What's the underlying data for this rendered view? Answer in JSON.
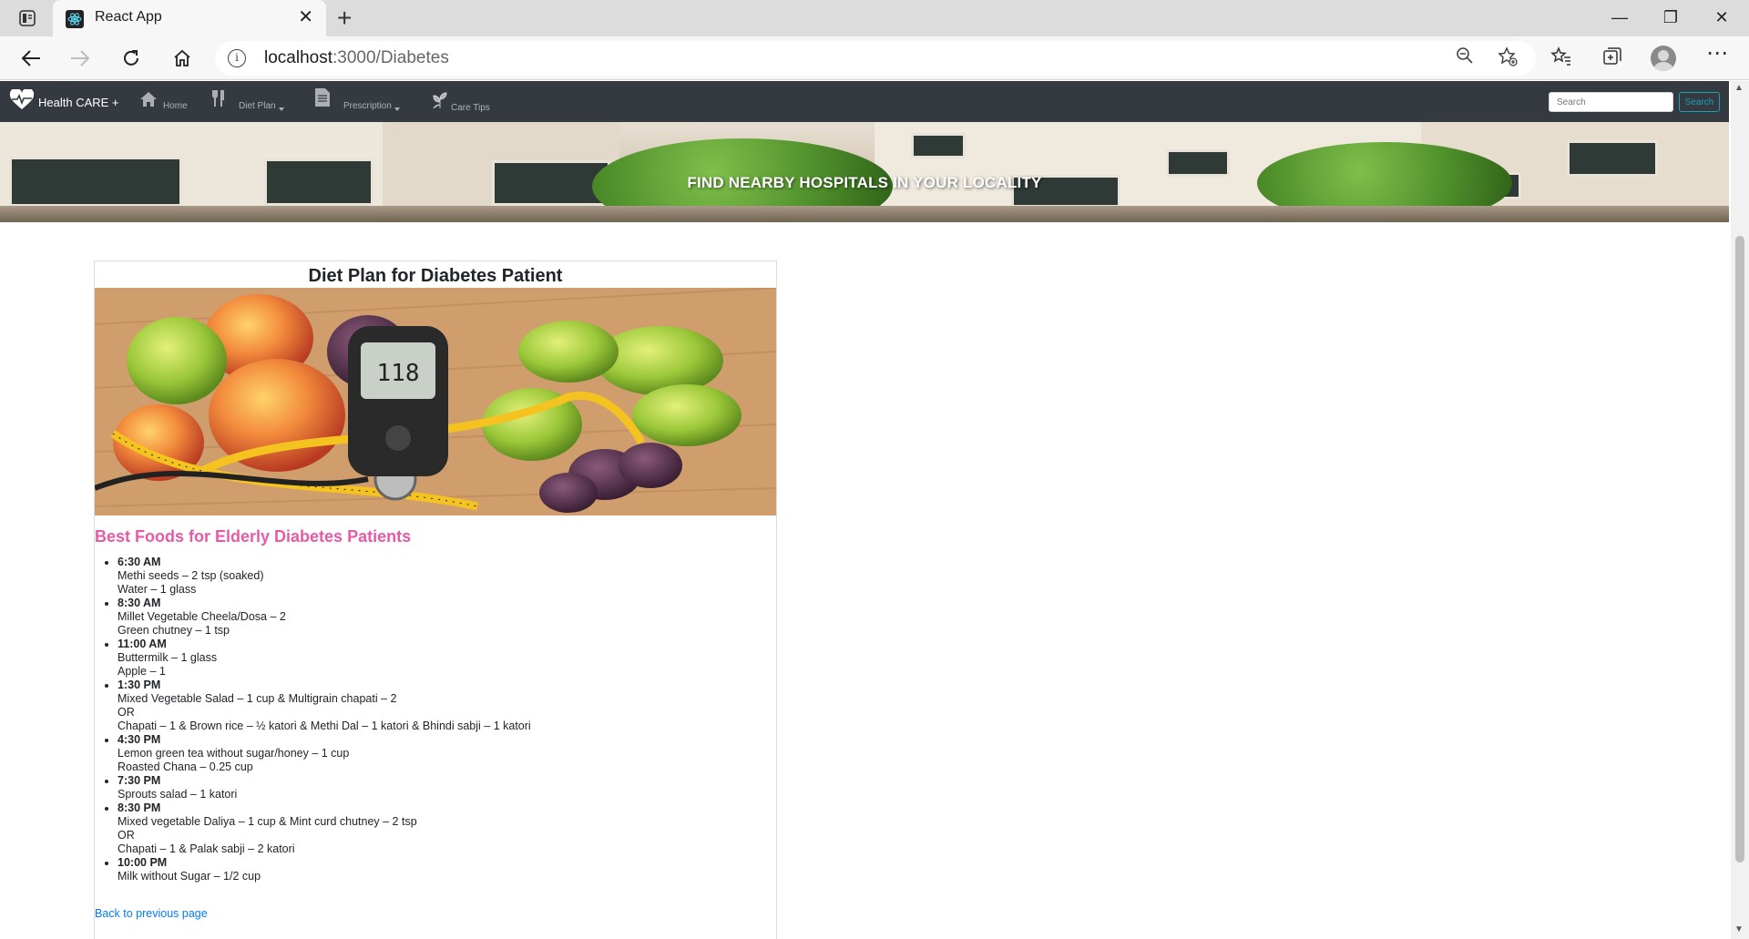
{
  "browser": {
    "tab_title": "React App",
    "url_host": "localhost",
    "url_rest": ":3000/Diabetes"
  },
  "navbar": {
    "brand": "Health CARE +",
    "items": [
      {
        "label": "Home",
        "icon": "home-icon"
      },
      {
        "label": "Diet Plan",
        "icon": "cutlery-icon",
        "dropdown": true
      },
      {
        "label": "Prescription",
        "icon": "document-icon",
        "dropdown": true
      },
      {
        "label": "Care Tips",
        "icon": "leaf-icon"
      }
    ],
    "search_placeholder": "Search",
    "search_button": "Search"
  },
  "hero": {
    "text": "FIND NEARBY HOSPITALS IN YOUR LOCALITY"
  },
  "card": {
    "title": "Diet Plan for Diabetes Patient",
    "glucometer_reading": "118",
    "section_heading": "Best Foods for Elderly Diabetes Patients",
    "schedule": [
      {
        "time": "6:30 AM",
        "lines": [
          "Methi seeds – 2 tsp (soaked)",
          "Water – 1 glass"
        ]
      },
      {
        "time": "8:30 AM",
        "lines": [
          "Millet Vegetable Cheela/Dosa – 2",
          "Green chutney – 1 tsp"
        ]
      },
      {
        "time": "11:00 AM",
        "lines": [
          "Buttermilk – 1 glass",
          "Apple – 1"
        ]
      },
      {
        "time": "1:30 PM",
        "lines": [
          "Mixed Vegetable Salad – 1 cup & Multigrain chapati – 2",
          "OR",
          "Chapati – 1 & Brown rice – ½ katori & Methi Dal – 1 katori & Bhindi sabji – 1 katori"
        ]
      },
      {
        "time": "4:30 PM",
        "lines": [
          "Lemon green tea without sugar/honey – 1 cup",
          "Roasted Chana – 0.25 cup"
        ]
      },
      {
        "time": "7:30 PM",
        "lines": [
          "Sprouts salad – 1 katori"
        ]
      },
      {
        "time": "8:30 PM",
        "lines": [
          "Mixed vegetable Daliya – 1 cup & Mint curd chutney – 2 tsp",
          "OR",
          "Chapati – 1 & Palak sabji – 2 katori"
        ]
      },
      {
        "time": "10:00 PM",
        "lines": [
          "Milk without Sugar – 1/2 cup"
        ]
      }
    ],
    "back_link": "Back to previous page"
  },
  "colors": {
    "navbar_bg": "#343a40",
    "section_heading": "#e85aa7",
    "link": "#007bff",
    "search_btn": "#17a2b8"
  }
}
